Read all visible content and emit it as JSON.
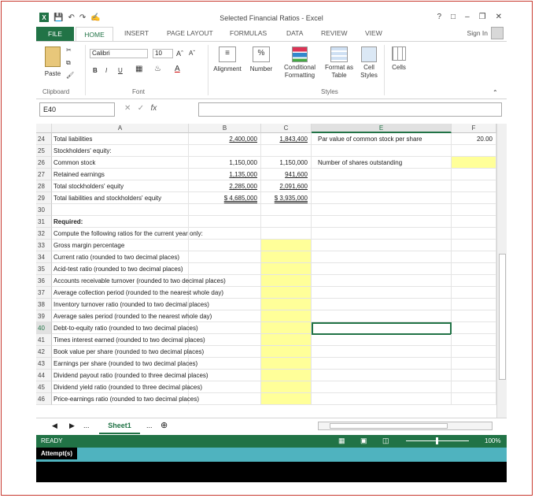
{
  "window": {
    "title": "Selected Financial Ratios - Excel",
    "help": "?",
    "signin": "Sign In"
  },
  "tabs": [
    "FILE",
    "HOME",
    "INSERT",
    "PAGE LAYOUT",
    "FORMULAS",
    "DATA",
    "REVIEW",
    "VIEW"
  ],
  "ribbon": {
    "paste": "Paste",
    "clipboard": "Clipboard",
    "font_name": "Calibri",
    "font_size": "10",
    "font_group": "Font",
    "alignment": "Alignment",
    "number": "Number",
    "conditional_1": "Conditional",
    "conditional_2": "Formatting",
    "format_as_1": "Format as",
    "format_as_2": "Table",
    "cell_styles_1": "Cell",
    "cell_styles_2": "Styles",
    "styles_group": "Styles",
    "cells": "Cells",
    "bold": "B",
    "italic": "I",
    "underline": "U"
  },
  "formula_bar": {
    "name_box": "E40",
    "fx": "fx",
    "value": ""
  },
  "columns": [
    "A",
    "B",
    "C",
    "E",
    "F"
  ],
  "rows": [
    {
      "n": "24",
      "a": "Total liabilities",
      "b": "2,400,000",
      "c": "1,843,400",
      "e": "Par value of common stock per share",
      "f": "20.00"
    },
    {
      "n": "25",
      "a": "Stockholders' equity:",
      "b": "",
      "c": "",
      "e": "",
      "f": ""
    },
    {
      "n": "26",
      "a": "  Common stock",
      "b": "1,150,000",
      "c": "1,150,000",
      "e": "Number of shares outstanding",
      "f": ""
    },
    {
      "n": "27",
      "a": "  Retained earnings",
      "b": "1,135,000",
      "c": "941,600",
      "e": "",
      "f": ""
    },
    {
      "n": "28",
      "a": "Total stockholders' equity",
      "b": "2,285,000",
      "c": "2,091,600",
      "e": "",
      "f": ""
    },
    {
      "n": "29",
      "a": "Total liabilities and stockholders' equity",
      "b": "$        4,685,000",
      "c": "$  3,935,000",
      "e": "",
      "f": ""
    },
    {
      "n": "30",
      "a": "",
      "b": "",
      "c": "",
      "e": "",
      "f": ""
    },
    {
      "n": "31",
      "a": "Required:",
      "b": "",
      "c": "",
      "e": "",
      "f": ""
    },
    {
      "n": "32",
      "a": "Compute the following ratios for the current year only:",
      "b": "",
      "c": "",
      "e": "",
      "f": ""
    },
    {
      "n": "33",
      "a": "  Gross margin percentage",
      "b": "",
      "c": "",
      "e": "",
      "f": ""
    },
    {
      "n": "34",
      "a": "  Current ratio (rounded to two decimal places)",
      "b": "",
      "c": "",
      "e": "",
      "f": ""
    },
    {
      "n": "35",
      "a": "  Acid-test ratio (rounded to two decimal places)",
      "b": "",
      "c": "",
      "e": "",
      "f": ""
    },
    {
      "n": "36",
      "a": "  Accounts receivable turnover (rounded to two decimal places)",
      "b": "",
      "c": "",
      "e": "",
      "f": ""
    },
    {
      "n": "37",
      "a": "  Average collection period (rounded to the nearest whole day)",
      "b": "",
      "c": "",
      "e": "",
      "f": ""
    },
    {
      "n": "38",
      "a": "  Inventory turnover ratio (rounded to two decimal places)",
      "b": "",
      "c": "",
      "e": "",
      "f": ""
    },
    {
      "n": "39",
      "a": "  Average sales period (rounded to the nearest whole day)",
      "b": "",
      "c": "",
      "e": "",
      "f": ""
    },
    {
      "n": "40",
      "a": "  Debt-to-equity ratio (rounded to two decimal places)",
      "b": "",
      "c": "",
      "e": "",
      "f": ""
    },
    {
      "n": "41",
      "a": "  Times interest earned (rounded to two decimal places)",
      "b": "",
      "c": "",
      "e": "",
      "f": ""
    },
    {
      "n": "42",
      "a": "  Book value per share (rounded to two decimal places)",
      "b": "",
      "c": "",
      "e": "",
      "f": ""
    },
    {
      "n": "43",
      "a": "  Earnings per share (rounded to two decimal places)",
      "b": "",
      "c": "",
      "e": "",
      "f": ""
    },
    {
      "n": "44",
      "a": "  Dividend payout ratio (rounded to three decimal places)",
      "b": "",
      "c": "",
      "e": "",
      "f": ""
    },
    {
      "n": "45",
      "a": "  Dividend yield ratio (rounded to three decimal places)",
      "b": "",
      "c": "",
      "e": "",
      "f": ""
    },
    {
      "n": "46",
      "a": "  Price-earnings ratio (rounded to two decimal places)",
      "b": "",
      "c": "",
      "e": "",
      "f": ""
    }
  ],
  "sheet_tab": "Sheet1",
  "ellipsis": "...",
  "status": {
    "ready": "READY",
    "zoom": "100%"
  },
  "attempt": "Attempt(s)",
  "colors": {
    "accent": "#217346",
    "input_fill": "#ffff99",
    "attempt_bar": "#4fb3bf"
  }
}
